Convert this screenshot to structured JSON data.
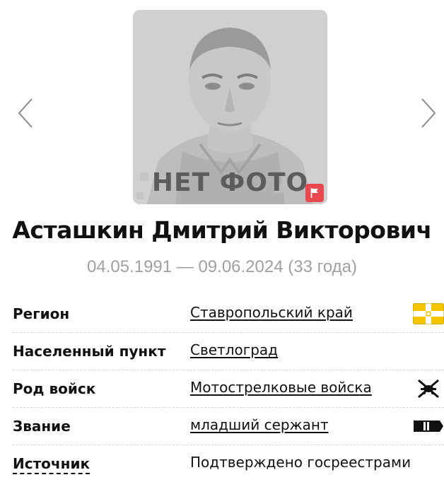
{
  "photo": {
    "placeholder_text": "НЕТ ФОТО",
    "flag_button": "flag-icon",
    "prev_icon": "chevron-left-icon",
    "next_icon": "chevron-right-icon"
  },
  "person": {
    "name": "Асташкин Дмитрий Викторович",
    "dates": "04.05.1991 — 09.06.2024 (33 года)"
  },
  "info": {
    "region": {
      "label": "Регион",
      "value": "Ставропольский край",
      "icon": "region-flag-icon"
    },
    "settlement": {
      "label": "Населенный пункт",
      "value": "Светлоград"
    },
    "branch": {
      "label": "Род войск",
      "value": "Мотострелковые войска",
      "icon": "motor-rifle-emblem-icon"
    },
    "rank": {
      "label": "Звание",
      "value": "младший сержант",
      "icon": "shoulder-strap-icon"
    },
    "source": {
      "label": "Источник",
      "value": "Подтверждено госреестрами"
    }
  },
  "colors": {
    "accent_red": "#e8494f",
    "muted_text": "#a0a0a0",
    "region_flag_yellow": "#f5c600"
  }
}
